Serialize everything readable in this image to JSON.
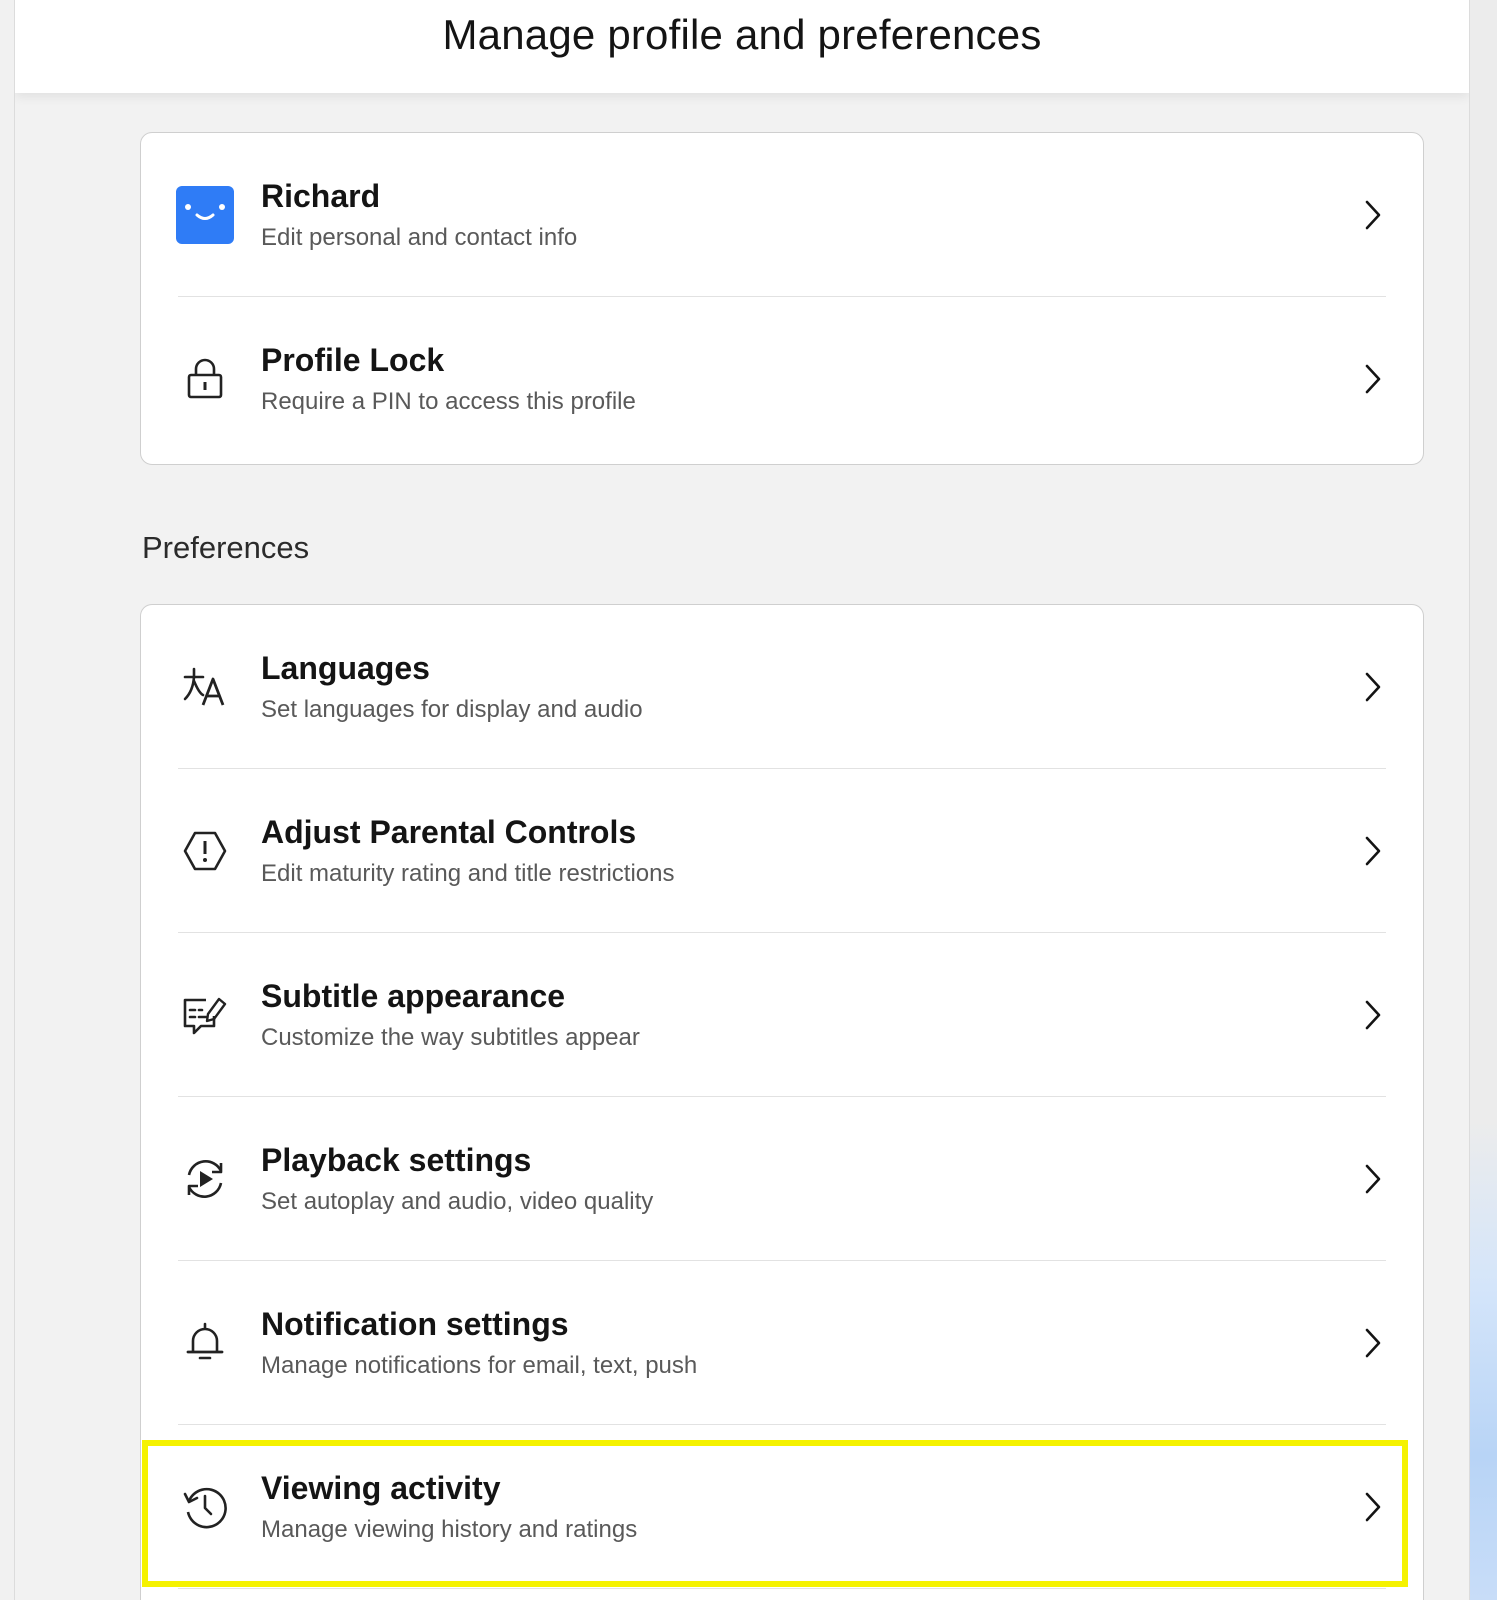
{
  "header": {
    "title": "Manage profile and preferences"
  },
  "profile_section": {
    "items": [
      {
        "title": "Richard",
        "subtitle": "Edit personal and contact info",
        "icon": "profile-avatar-icon"
      },
      {
        "title": "Profile Lock",
        "subtitle": "Require a PIN to access this profile",
        "icon": "lock-icon"
      }
    ]
  },
  "preferences": {
    "label": "Preferences",
    "items": [
      {
        "title": "Languages",
        "subtitle": "Set languages for display and audio",
        "icon": "language-icon"
      },
      {
        "title": "Adjust Parental Controls",
        "subtitle": "Edit maturity rating and title restrictions",
        "icon": "parental-controls-icon"
      },
      {
        "title": "Subtitle appearance",
        "subtitle": "Customize the way subtitles appear",
        "icon": "subtitle-icon"
      },
      {
        "title": "Playback settings",
        "subtitle": "Set autoplay and audio, video quality",
        "icon": "playback-icon"
      },
      {
        "title": "Notification settings",
        "subtitle": "Manage notifications for email, text, push",
        "icon": "bell-icon"
      },
      {
        "title": "Viewing activity",
        "subtitle": "Manage viewing history and ratings",
        "icon": "history-icon"
      }
    ]
  },
  "colors": {
    "highlight": "#f5f200",
    "avatar": "#2f7cf6"
  }
}
